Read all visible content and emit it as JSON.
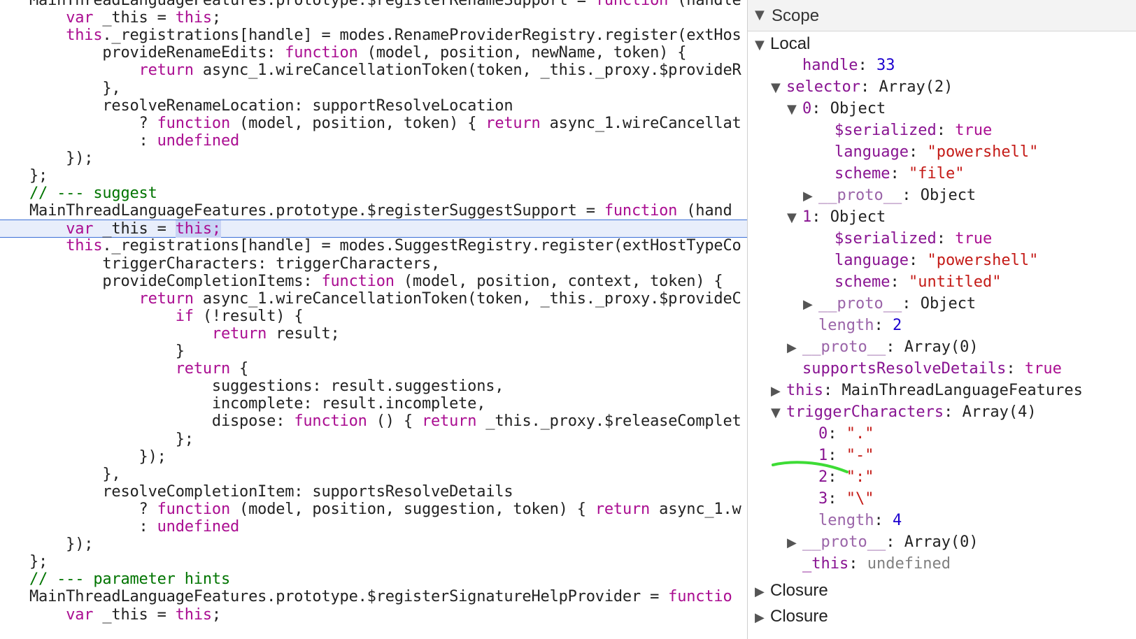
{
  "code_lines": [
    {
      "segments": [
        {
          "t": "MainThreadLanguageFeatures.prototype.$registerRenameSupport = ",
          "c": ""
        },
        {
          "t": "function",
          "c": "kw"
        },
        {
          "t": " (handle",
          "c": ""
        }
      ]
    },
    {
      "segments": [
        {
          "t": "    ",
          "c": ""
        },
        {
          "t": "var",
          "c": "kw"
        },
        {
          "t": " _this = ",
          "c": ""
        },
        {
          "t": "this",
          "c": "kw"
        },
        {
          "t": ";",
          "c": ""
        }
      ]
    },
    {
      "segments": [
        {
          "t": "    ",
          "c": ""
        },
        {
          "t": "this",
          "c": "kw"
        },
        {
          "t": "._registrations[handle] = modes.RenameProviderRegistry.register(extHos",
          "c": ""
        }
      ]
    },
    {
      "segments": [
        {
          "t": "        provideRenameEdits: ",
          "c": ""
        },
        {
          "t": "function",
          "c": "kw"
        },
        {
          "t": " (model, position, newName, token) {",
          "c": ""
        }
      ]
    },
    {
      "segments": [
        {
          "t": "            ",
          "c": ""
        },
        {
          "t": "return",
          "c": "kw"
        },
        {
          "t": " async_1.wireCancellationToken(token, _this._proxy.$provideR",
          "c": ""
        }
      ]
    },
    {
      "segments": [
        {
          "t": "        },",
          "c": ""
        }
      ]
    },
    {
      "segments": [
        {
          "t": "        resolveRenameLocation: supportResolveLocation",
          "c": ""
        }
      ]
    },
    {
      "segments": [
        {
          "t": "            ? ",
          "c": ""
        },
        {
          "t": "function",
          "c": "kw"
        },
        {
          "t": " (model, position, token) { ",
          "c": ""
        },
        {
          "t": "return",
          "c": "kw"
        },
        {
          "t": " async_1.wireCancellat",
          "c": ""
        }
      ]
    },
    {
      "segments": [
        {
          "t": "            : ",
          "c": ""
        },
        {
          "t": "undefined",
          "c": "kw"
        }
      ]
    },
    {
      "segments": [
        {
          "t": "    });",
          "c": ""
        }
      ]
    },
    {
      "segments": [
        {
          "t": "};",
          "c": ""
        }
      ]
    },
    {
      "segments": [
        {
          "t": "// --- suggest",
          "c": "cm"
        }
      ]
    },
    {
      "segments": [
        {
          "t": "MainThreadLanguageFeatures.prototype.$registerSuggestSupport = ",
          "c": ""
        },
        {
          "t": "function",
          "c": "kw"
        },
        {
          "t": " (hand",
          "c": ""
        }
      ]
    },
    {
      "highlight": true,
      "segments": [
        {
          "t": "    ",
          "c": ""
        },
        {
          "t": "var",
          "c": "kw"
        },
        {
          "t": " _this = ",
          "c": ""
        },
        {
          "t": "this;",
          "c": "kw sel"
        }
      ]
    },
    {
      "segments": [
        {
          "t": "    ",
          "c": ""
        },
        {
          "t": "this",
          "c": "kw"
        },
        {
          "t": "._registrations[handle] = modes.SuggestRegistry.register(extHostTypeCo",
          "c": ""
        }
      ]
    },
    {
      "segments": [
        {
          "t": "        triggerCharacters: triggerCharacters,",
          "c": ""
        }
      ]
    },
    {
      "segments": [
        {
          "t": "        provideCompletionItems: ",
          "c": ""
        },
        {
          "t": "function",
          "c": "kw"
        },
        {
          "t": " (model, position, context, token) {",
          "c": ""
        }
      ]
    },
    {
      "segments": [
        {
          "t": "            ",
          "c": ""
        },
        {
          "t": "return",
          "c": "kw"
        },
        {
          "t": " async_1.wireCancellationToken(token, _this._proxy.$provideC",
          "c": ""
        }
      ]
    },
    {
      "segments": [
        {
          "t": "                ",
          "c": ""
        },
        {
          "t": "if",
          "c": "kw"
        },
        {
          "t": " (!result) {",
          "c": ""
        }
      ]
    },
    {
      "segments": [
        {
          "t": "                    ",
          "c": ""
        },
        {
          "t": "return",
          "c": "kw"
        },
        {
          "t": " result;",
          "c": ""
        }
      ]
    },
    {
      "segments": [
        {
          "t": "                }",
          "c": ""
        }
      ]
    },
    {
      "segments": [
        {
          "t": "                ",
          "c": ""
        },
        {
          "t": "return",
          "c": "kw"
        },
        {
          "t": " {",
          "c": ""
        }
      ]
    },
    {
      "segments": [
        {
          "t": "                    suggestions: result.suggestions,",
          "c": ""
        }
      ]
    },
    {
      "segments": [
        {
          "t": "                    incomplete: result.incomplete,",
          "c": ""
        }
      ]
    },
    {
      "segments": [
        {
          "t": "                    dispose: ",
          "c": ""
        },
        {
          "t": "function",
          "c": "kw"
        },
        {
          "t": " () { ",
          "c": ""
        },
        {
          "t": "return",
          "c": "kw"
        },
        {
          "t": " _this._proxy.$releaseComplet",
          "c": ""
        }
      ]
    },
    {
      "segments": [
        {
          "t": "                };",
          "c": ""
        }
      ]
    },
    {
      "segments": [
        {
          "t": "            });",
          "c": ""
        }
      ]
    },
    {
      "segments": [
        {
          "t": "        },",
          "c": ""
        }
      ]
    },
    {
      "segments": [
        {
          "t": "        resolveCompletionItem: supportsResolveDetails",
          "c": ""
        }
      ]
    },
    {
      "segments": [
        {
          "t": "            ? ",
          "c": ""
        },
        {
          "t": "function",
          "c": "kw"
        },
        {
          "t": " (model, position, suggestion, token) { ",
          "c": ""
        },
        {
          "t": "return",
          "c": "kw"
        },
        {
          "t": " async_1.w",
          "c": ""
        }
      ]
    },
    {
      "segments": [
        {
          "t": "            : ",
          "c": ""
        },
        {
          "t": "undefined",
          "c": "kw"
        }
      ]
    },
    {
      "segments": [
        {
          "t": "    });",
          "c": ""
        }
      ]
    },
    {
      "segments": [
        {
          "t": "};",
          "c": ""
        }
      ]
    },
    {
      "segments": [
        {
          "t": "// --- parameter hints",
          "c": "cm"
        }
      ]
    },
    {
      "segments": [
        {
          "t": "MainThreadLanguageFeatures.prototype.$registerSignatureHelpProvider = ",
          "c": ""
        },
        {
          "t": "functio",
          "c": "kw"
        }
      ]
    },
    {
      "segments": [
        {
          "t": "    ",
          "c": ""
        },
        {
          "t": "var",
          "c": "kw"
        },
        {
          "t": " _this = ",
          "c": ""
        },
        {
          "t": "this",
          "c": "kw"
        },
        {
          "t": ";",
          "c": ""
        }
      ]
    }
  ],
  "scope": {
    "title": "Scope",
    "rows": [
      {
        "indent": 0,
        "tri": "down",
        "section": true,
        "segments": [
          {
            "t": "Local",
            "c": ""
          }
        ]
      },
      {
        "indent": 2,
        "segments": [
          {
            "t": "handle",
            "c": "k"
          },
          {
            "t": ": ",
            "c": ""
          },
          {
            "t": "33",
            "c": "num"
          }
        ]
      },
      {
        "indent": 1,
        "tri": "down",
        "segments": [
          {
            "t": "selector",
            "c": "k"
          },
          {
            "t": ": Array(2)",
            "c": ""
          }
        ]
      },
      {
        "indent": 2,
        "tri": "down",
        "segments": [
          {
            "t": "0",
            "c": "k"
          },
          {
            "t": ": Object",
            "c": ""
          }
        ]
      },
      {
        "indent": 4,
        "segments": [
          {
            "t": "$serialized",
            "c": "k"
          },
          {
            "t": ": ",
            "c": ""
          },
          {
            "t": "true",
            "c": "bool"
          }
        ]
      },
      {
        "indent": 4,
        "segments": [
          {
            "t": "language",
            "c": "k"
          },
          {
            "t": ": ",
            "c": ""
          },
          {
            "t": "\"powershell\"",
            "c": "str"
          }
        ]
      },
      {
        "indent": 4,
        "segments": [
          {
            "t": "scheme",
            "c": "k"
          },
          {
            "t": ": ",
            "c": ""
          },
          {
            "t": "\"file\"",
            "c": "str"
          }
        ]
      },
      {
        "indent": 3,
        "tri": "right",
        "segments": [
          {
            "t": "__proto__",
            "c": "kd"
          },
          {
            "t": ": Object",
            "c": ""
          }
        ]
      },
      {
        "indent": 2,
        "tri": "down",
        "segments": [
          {
            "t": "1",
            "c": "k"
          },
          {
            "t": ": Object",
            "c": ""
          }
        ]
      },
      {
        "indent": 4,
        "segments": [
          {
            "t": "$serialized",
            "c": "k"
          },
          {
            "t": ": ",
            "c": ""
          },
          {
            "t": "true",
            "c": "bool"
          }
        ]
      },
      {
        "indent": 4,
        "segments": [
          {
            "t": "language",
            "c": "k"
          },
          {
            "t": ": ",
            "c": ""
          },
          {
            "t": "\"powershell\"",
            "c": "str"
          }
        ]
      },
      {
        "indent": 4,
        "segments": [
          {
            "t": "scheme",
            "c": "k"
          },
          {
            "t": ": ",
            "c": ""
          },
          {
            "t": "\"untitled\"",
            "c": "str"
          }
        ]
      },
      {
        "indent": 3,
        "tri": "right",
        "segments": [
          {
            "t": "__proto__",
            "c": "kd"
          },
          {
            "t": ": Object",
            "c": ""
          }
        ]
      },
      {
        "indent": 3,
        "segments": [
          {
            "t": "length",
            "c": "kd"
          },
          {
            "t": ": ",
            "c": ""
          },
          {
            "t": "2",
            "c": "num"
          }
        ]
      },
      {
        "indent": 2,
        "tri": "right",
        "segments": [
          {
            "t": "__proto__",
            "c": "kd"
          },
          {
            "t": ": Array(0)",
            "c": ""
          }
        ]
      },
      {
        "indent": 2,
        "segments": [
          {
            "t": "supportsResolveDetails",
            "c": "k"
          },
          {
            "t": ": ",
            "c": ""
          },
          {
            "t": "true",
            "c": "bool"
          }
        ]
      },
      {
        "indent": 1,
        "tri": "right",
        "segments": [
          {
            "t": "this",
            "c": "k"
          },
          {
            "t": ": MainThreadLanguageFeatures",
            "c": ""
          }
        ]
      },
      {
        "indent": 1,
        "tri": "down",
        "segments": [
          {
            "t": "triggerCharacters",
            "c": "k"
          },
          {
            "t": ": Array(4)",
            "c": ""
          }
        ]
      },
      {
        "indent": 3,
        "segments": [
          {
            "t": "0",
            "c": "k"
          },
          {
            "t": ": ",
            "c": ""
          },
          {
            "t": "\".\"",
            "c": "str"
          }
        ]
      },
      {
        "indent": 3,
        "segments": [
          {
            "t": "1",
            "c": "k"
          },
          {
            "t": ": ",
            "c": ""
          },
          {
            "t": "\"-\"",
            "c": "str"
          }
        ]
      },
      {
        "indent": 3,
        "segments": [
          {
            "t": "2",
            "c": "k"
          },
          {
            "t": ": ",
            "c": ""
          },
          {
            "t": "\":\"",
            "c": "str"
          }
        ]
      },
      {
        "indent": 3,
        "segments": [
          {
            "t": "3",
            "c": "k"
          },
          {
            "t": ": ",
            "c": ""
          },
          {
            "t": "\"\\\"",
            "c": "str"
          }
        ]
      },
      {
        "indent": 3,
        "segments": [
          {
            "t": "length",
            "c": "kd"
          },
          {
            "t": ": ",
            "c": ""
          },
          {
            "t": "4",
            "c": "num"
          }
        ]
      },
      {
        "indent": 2,
        "tri": "right",
        "segments": [
          {
            "t": "__proto__",
            "c": "kd"
          },
          {
            "t": ": Array(0)",
            "c": ""
          }
        ]
      },
      {
        "indent": 2,
        "segments": [
          {
            "t": "_this",
            "c": "k"
          },
          {
            "t": ": ",
            "c": ""
          },
          {
            "t": "undefined",
            "c": "und"
          }
        ]
      },
      {
        "indent": 0,
        "tri": "right",
        "section": true,
        "segments": [
          {
            "t": "Closure",
            "c": ""
          }
        ]
      },
      {
        "indent": 0,
        "tri": "right",
        "section": true,
        "segments": [
          {
            "t": "Closure",
            "c": ""
          }
        ]
      }
    ]
  },
  "colors": {
    "keyword": "#aa0d91",
    "comment": "#007400",
    "string": "#c41a16",
    "number": "#1c00cf",
    "property": "#881391",
    "highlight_line": "#e8eefb",
    "selection": "#c9d4f5",
    "annotation_stroke": "#3ddc35"
  },
  "annotation": "green underline beneath triggerCharacters item 1"
}
